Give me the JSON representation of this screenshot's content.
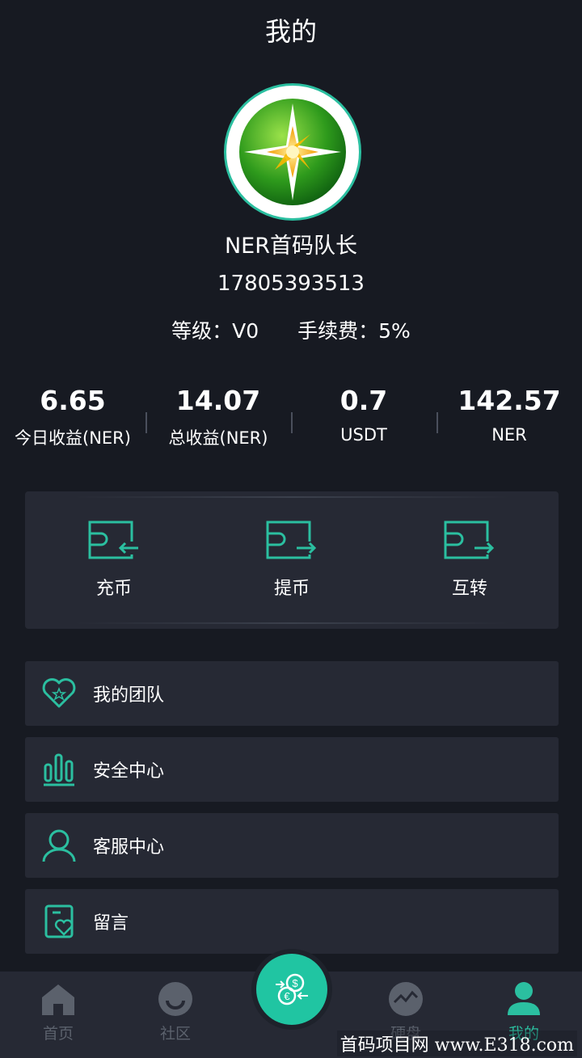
{
  "header": {
    "title": "我的"
  },
  "profile": {
    "name": "NER首码队长",
    "phone": "17805393513",
    "level": "等级：V0",
    "fee": "手续费：5%"
  },
  "stats": [
    {
      "value": "6.65",
      "label": "今日收益(NER)"
    },
    {
      "value": "14.07",
      "label": "总收益(NER)"
    },
    {
      "value": "0.7",
      "label": "USDT"
    },
    {
      "value": "142.57",
      "label": "NER"
    }
  ],
  "actions": [
    {
      "label": "充币",
      "icon": "wallet-in-icon"
    },
    {
      "label": "提币",
      "icon": "wallet-out-icon"
    },
    {
      "label": "互转",
      "icon": "wallet-transfer-icon"
    }
  ],
  "menu": [
    {
      "label": "我的团队",
      "icon": "heart-star-icon"
    },
    {
      "label": "安全中心",
      "icon": "bar-chart-icon"
    },
    {
      "label": "客服中心",
      "icon": "user-icon"
    },
    {
      "label": "留言",
      "icon": "message-heart-icon"
    }
  ],
  "tabbar": {
    "items": [
      {
        "label": "首页",
        "icon": "home-icon"
      },
      {
        "label": "社区",
        "icon": "smile-icon"
      },
      {
        "label": "硬盘",
        "icon": "pulse-icon"
      },
      {
        "label": "我的",
        "icon": "profile-icon",
        "active": true
      }
    ],
    "center_icon": "currency-exchange-icon"
  },
  "colors": {
    "accent": "#2bbfa0",
    "background": "#171a22",
    "card": "#262934"
  },
  "watermark": "首码项目网 www.E318.com"
}
